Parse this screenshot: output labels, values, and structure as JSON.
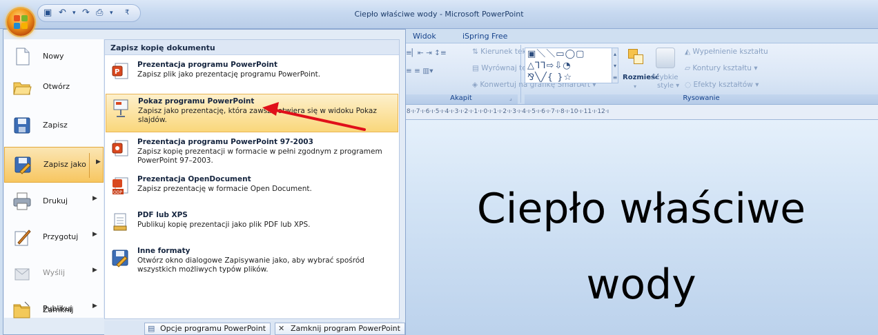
{
  "window": {
    "title": "Ciepło właściwe wody - Microsoft PowerPoint",
    "quick_access": [
      "save-icon",
      "undo-icon",
      "redo-icon",
      "print-icon"
    ]
  },
  "ribbon": {
    "tabs": [
      "Widok",
      "iSpring Free"
    ],
    "paragraph": {
      "items": [
        "Kierunek tekstu",
        "Wyrównaj tekst",
        "Konwertuj na grafikę SmartArt"
      ],
      "group_label": "Akapit"
    },
    "drawing": {
      "arrange_label": "Rozmieść",
      "quick_styles_label": "Szybkie",
      "quick_styles_label2": "style",
      "items": [
        "Wypełnienie kształtu",
        "Kontury kształtu",
        "Efekty kształtów"
      ],
      "group_label": "Rysowanie"
    }
  },
  "ruler": {
    "ticks": "·8·ı·7·ı·6·ı·5·ı·4·ı·3·ı·2·ı·1·ı·0·ı·1·ı·2·ı·3·ı·4·ı·5·ı·6·ı·7·ı·8·ı·10·ı·11·ı·12·ı"
  },
  "slide": {
    "title_line1": "Ciepło właściwe",
    "title_line2": "wody"
  },
  "office_menu": {
    "left_items": [
      {
        "label": "Nowy",
        "icon": "new-document-icon"
      },
      {
        "label": "Otwórz",
        "icon": "open-folder-icon"
      },
      {
        "label": "Zapisz",
        "icon": "save-icon"
      },
      {
        "label": "Zapisz jako",
        "icon": "save-as-icon"
      },
      {
        "label": "Drukuj",
        "icon": "print-icon"
      },
      {
        "label": "Przygotuj",
        "icon": "prepare-icon"
      },
      {
        "label": "Wyślij",
        "icon": "send-icon"
      },
      {
        "label": "Publikuj",
        "icon": "publish-icon"
      },
      {
        "label": "Zamknij",
        "icon": "close-folder-icon"
      }
    ],
    "submenu_header": "Zapisz kopię dokumentu",
    "save_options": [
      {
        "title": "Prezentacja programu PowerPoint",
        "desc": "Zapisz plik jako prezentację programu PowerPoint.",
        "icon": "pptx-icon"
      },
      {
        "title": "Pokaz programu PowerPoint",
        "desc": "Zapisz jako prezentację, która zawsze otwiera się w widoku  Pokaz slajdów.",
        "icon": "ppsx-icon"
      },
      {
        "title": "Prezentacja programu PowerPoint 97-2003",
        "desc": "Zapisz kopię prezentacji w formacie w pełni zgodnym z programem PowerPoint 97–2003.",
        "icon": "ppt-icon"
      },
      {
        "title": "Prezentacja OpenDocument",
        "desc": "Zapisz prezentację w formacie Open Document.",
        "icon": "odp-icon"
      },
      {
        "title": "PDF lub XPS",
        "desc": "Publikuj kopię prezentacji jako plik PDF lub XPS.",
        "icon": "pdf-xps-icon"
      },
      {
        "title": "Inne formaty",
        "desc": "Otwórz okno dialogowe Zapisywanie jako, aby wybrać spośród wszystkich możliwych typów plików.",
        "icon": "other-formats-icon"
      }
    ],
    "footer": {
      "options_label": "Opcje programu PowerPoint",
      "exit_label": "Zamknij program PowerPoint"
    }
  },
  "colors": {
    "highlight": "#fad77b",
    "arrow": "#e0101a",
    "menu_text": "#15253f"
  }
}
